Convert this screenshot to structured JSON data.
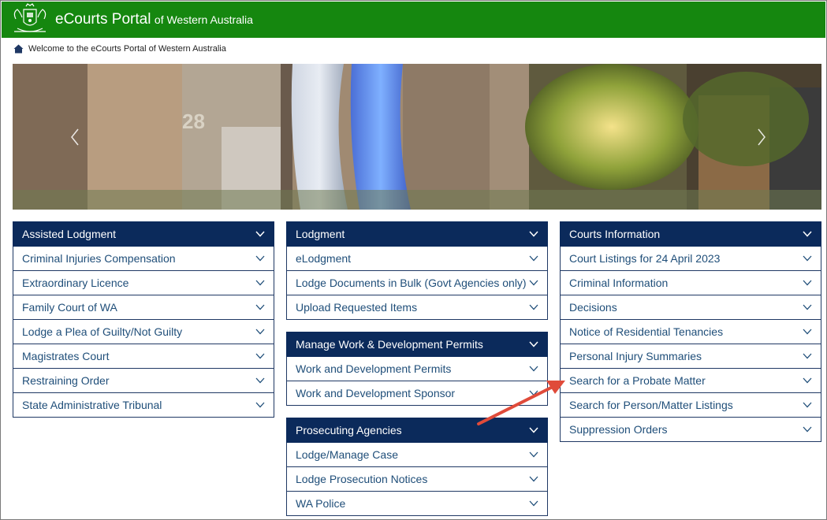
{
  "header": {
    "brand_main": "eCourts Portal",
    "brand_sub": "of Western Australia",
    "bg_color": "#15870f"
  },
  "breadcrumb": {
    "icon": "home-icon",
    "text": "Welcome to the eCourts Portal of Western Australia"
  },
  "banner": {
    "building_number": "28",
    "prev_icon": "chevron-left-icon",
    "next_icon": "chevron-right-icon"
  },
  "panels": {
    "assisted": {
      "title": "Assisted Lodgment",
      "items": [
        "Criminal Injuries Compensation",
        "Extraordinary Licence",
        "Family Court of WA",
        "Lodge a Plea of Guilty/Not Guilty",
        "Magistrates Court",
        "Restraining Order",
        "State Administrative Tribunal"
      ]
    },
    "lodgment": {
      "title": "Lodgment",
      "items": [
        "eLodgment",
        "Lodge Documents in Bulk (Govt Agencies only)",
        "Upload Requested Items"
      ]
    },
    "permits": {
      "title": "Manage Work & Development Permits",
      "items": [
        "Work and Development Permits",
        "Work and Development Sponsor"
      ]
    },
    "prosecuting": {
      "title": "Prosecuting Agencies",
      "items": [
        "Lodge/Manage Case",
        "Lodge Prosecution Notices",
        "WA Police"
      ]
    },
    "courts": {
      "title": "Courts Information",
      "items": [
        "Court Listings for 24 April 2023",
        "Criminal Information",
        "Decisions",
        "Notice of Residential Tenancies",
        "Personal Injury Summaries",
        "Search for a Probate Matter",
        "Search for Person/Matter Listings",
        "Suppression Orders"
      ]
    }
  },
  "colors": {
    "panel_header": "#0b2a5b",
    "item_text": "#1f4e79",
    "annotation_arrow": "#e04b3a"
  }
}
